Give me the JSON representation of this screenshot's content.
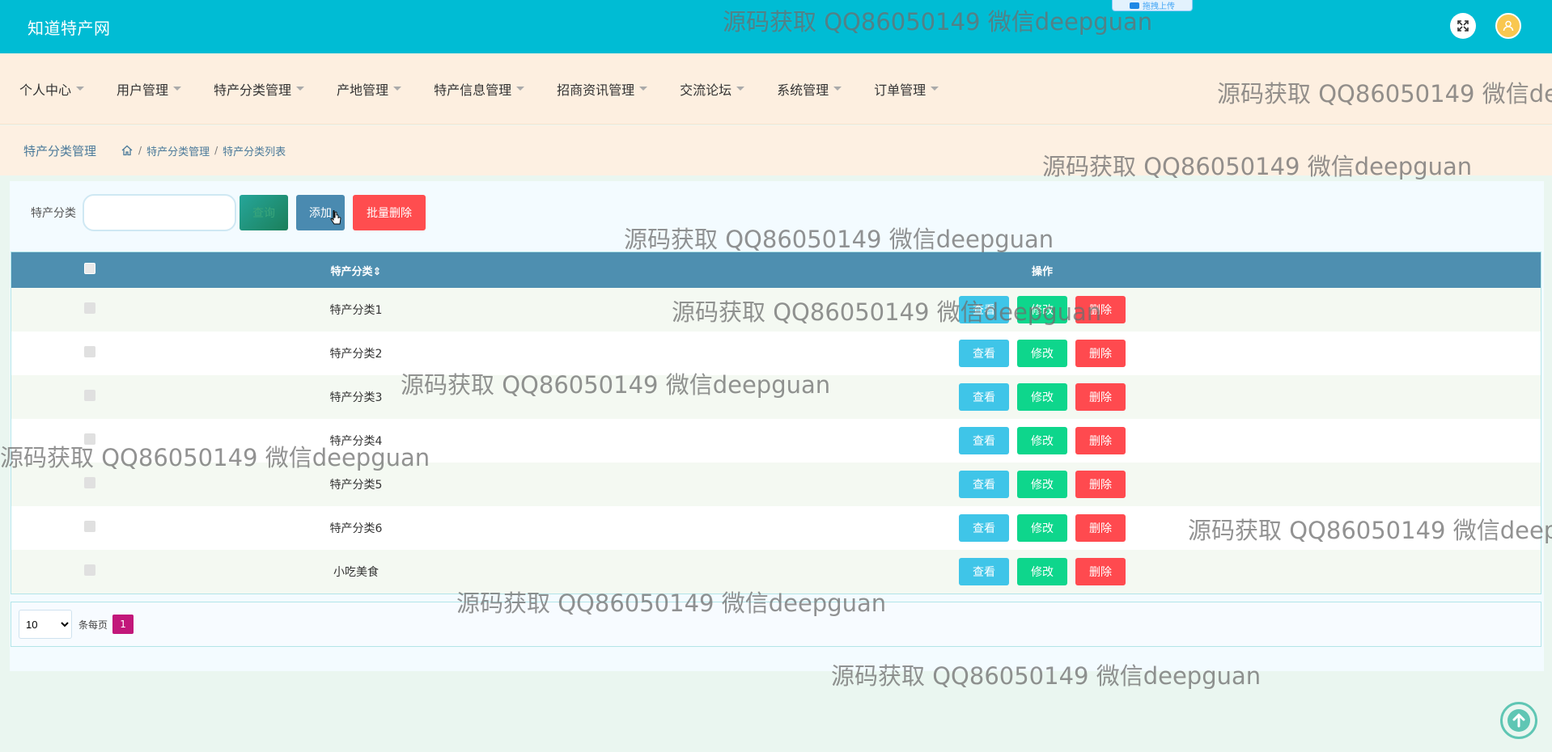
{
  "header": {
    "site_title": "知道特产网",
    "upload_tab": "拖拽上传"
  },
  "nav": {
    "items": [
      {
        "label": "个人中心"
      },
      {
        "label": "用户管理"
      },
      {
        "label": "特产分类管理"
      },
      {
        "label": "产地管理"
      },
      {
        "label": "特产信息管理"
      },
      {
        "label": "招商资讯管理"
      },
      {
        "label": "交流论坛"
      },
      {
        "label": "系统管理"
      },
      {
        "label": "订单管理"
      }
    ]
  },
  "breadcrumb": {
    "section": "特产分类管理",
    "sep": "/",
    "level1": "特产分类管理",
    "level2": "特产分类列表"
  },
  "search": {
    "label": "特产分类",
    "value": "",
    "search_button": "查询",
    "add_button": "添加",
    "batch_delete_button": "批量删除"
  },
  "table": {
    "headers": {
      "name": "特产分类",
      "sort_indicator": "⇕",
      "ops": "操作"
    },
    "rows": [
      {
        "name": "特产分类1"
      },
      {
        "name": "特产分类2"
      },
      {
        "name": "特产分类3"
      },
      {
        "name": "特产分类4"
      },
      {
        "name": "特产分类5"
      },
      {
        "name": "特产分类6"
      },
      {
        "name": "小吃美食"
      }
    ],
    "op_labels": {
      "view": "查看",
      "edit": "修改",
      "delete": "删除"
    }
  },
  "pager": {
    "page_size": "10",
    "page_size_options": [
      "10"
    ],
    "per_page_label": "条每页",
    "current_page": "1"
  },
  "watermark": {
    "text": "源码获取 QQ86050149 微信deepguan"
  },
  "colors": {
    "topbar": "#00bcd4",
    "navbar": "#fdefe0",
    "table_header": "#4e8fb0",
    "view": "#3fc5e8",
    "edit": "#0ed68c",
    "delete": "#ff4a4f",
    "page_active": "#c2177a"
  },
  "icons": {
    "expand": "expand-icon",
    "user": "user-icon",
    "home": "home-icon",
    "back_to_top": "arrow-up-icon",
    "nav_caret": "caret-down-icon"
  }
}
